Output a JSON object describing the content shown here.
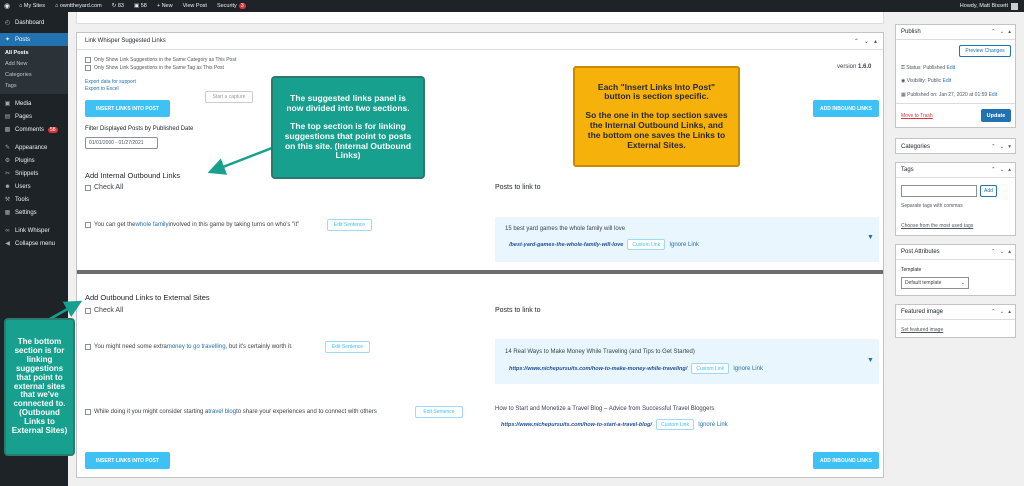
{
  "adminbar": {
    "items": [
      "My Sites",
      "ownttheyard.com",
      "83",
      "58",
      "+ New",
      "View Post",
      "Security"
    ],
    "security_badge": "3",
    "howdy": "Howdy, Matt Bissett"
  },
  "sidebar": {
    "items": [
      {
        "label": "Dashboard",
        "icon": "dashboard-icon"
      },
      {
        "label": "Posts",
        "icon": "pin-icon"
      },
      {
        "label": "Media",
        "icon": "media-icon"
      },
      {
        "label": "Pages",
        "icon": "pages-icon"
      },
      {
        "label": "Comments",
        "icon": "comment-icon",
        "count": "58"
      },
      {
        "label": "Appearance",
        "icon": "brush-icon"
      },
      {
        "label": "Plugins",
        "icon": "plug-icon"
      },
      {
        "label": "Snippets",
        "icon": "scissors-icon"
      },
      {
        "label": "Users",
        "icon": "user-icon"
      },
      {
        "label": "Tools",
        "icon": "wrench-icon"
      },
      {
        "label": "Settings",
        "icon": "settings-icon"
      },
      {
        "label": "Link Whisper",
        "icon": "link-icon"
      },
      {
        "label": "Collapse menu",
        "icon": "collapse-icon"
      }
    ],
    "submenu": [
      "All Posts",
      "Add New",
      "Categories",
      "Tags"
    ]
  },
  "panel": {
    "title": "Link Whisper Suggested Links",
    "opt1": "Only Show Link Suggestions in the Same Category as This Post",
    "opt2": "Only Show Link Suggestions in the Same Tag as This Post",
    "export_support": "Export data for support",
    "export_excel": "Export to Excel",
    "version_label": "version",
    "version": "1.6.0",
    "insert_btn": "INSERT LINKS INTO POST",
    "capture_btn": "Start a capture",
    "add_inbound": "ADD INBOUND LINKS",
    "filter_label": "Filter Displayed Posts by Published Date",
    "date_from": "01/01/2000",
    "date_to": "01/27/2021",
    "internal_title": "Add Internal Outbound Links",
    "check_all": "Check All",
    "posts_to_link": "Posts to link to",
    "s1_pre": "You can get the ",
    "s1_link": "whole family",
    "s1_post": " involved in this game by taking turns on who's \"it\"",
    "edit_sentence": "Edit Sentence",
    "sug1_title": "15 best yard games the whole family will love",
    "sug1_url": "/best-yard-games-the-whole-family-will-love",
    "custom_link": "Custom Link",
    "ignore_link": "Ignore Link",
    "external_title": "Add Outbound Links to External Sites",
    "s2_pre": "You might need some extra ",
    "s2_link": "money to go travelling",
    "s2_post": " , but it's certainly worth it.",
    "sug2_title": "14 Real Ways to Make Money While Traveling (and Tips to Get Started)",
    "sug2_url": "https://www.nichepursuits.com/how-to-make-money-while-traveling/",
    "s3_pre": "While doing it you might consider starting a ",
    "s3_link": "travel blog",
    "s3_post": " to share your experiences and to connect with others",
    "sug3_title": "How to Start and Monetize a Travel Blog – Advice from Successful Travel Bloggers",
    "sug3_url": "https://www.nichepursuits.com/how-to-start-a-travel-blog/"
  },
  "publish": {
    "title": "Publish",
    "preview": "Preview Changes",
    "status": "Status: Published",
    "visibility": "Visibility: Public",
    "published_on": "Published on: Jan 27, 2020 at 01:59",
    "edit": "Edit",
    "trash": "Move to Trash",
    "update": "Update"
  },
  "categories": {
    "title": "Categories"
  },
  "tags": {
    "title": "Tags",
    "add": "Add",
    "hint": "Separate tags with commas",
    "choose": "Choose from the most used tags"
  },
  "post_attributes": {
    "title": "Post Attributes",
    "template_label": "Template",
    "template_value": "Default template"
  },
  "featured": {
    "title": "Featured image",
    "set": "Set featured image"
  },
  "callouts": {
    "top_p1": "The suggested links panel is now divided into two sections.",
    "top_p2": "The top section is for linking suggestions that point to posts on this site. (Internal Outbound Links)",
    "right_p1": "Each \"Insert Links Into Post\" button is section specific.",
    "right_p2": "So the one in the top section saves the Internal Outbound Links, and the bottom one saves the Links to External Sites.",
    "left": "The bottom section is for linking suggestions that point to external sites that we've connected to. (Outbound Links to External Sites)"
  },
  "colors": {
    "accent": "#3ec1f5",
    "callout_teal": "#16a08d",
    "callout_orange": "#f6b10a",
    "wp_blue": "#2271b1"
  }
}
